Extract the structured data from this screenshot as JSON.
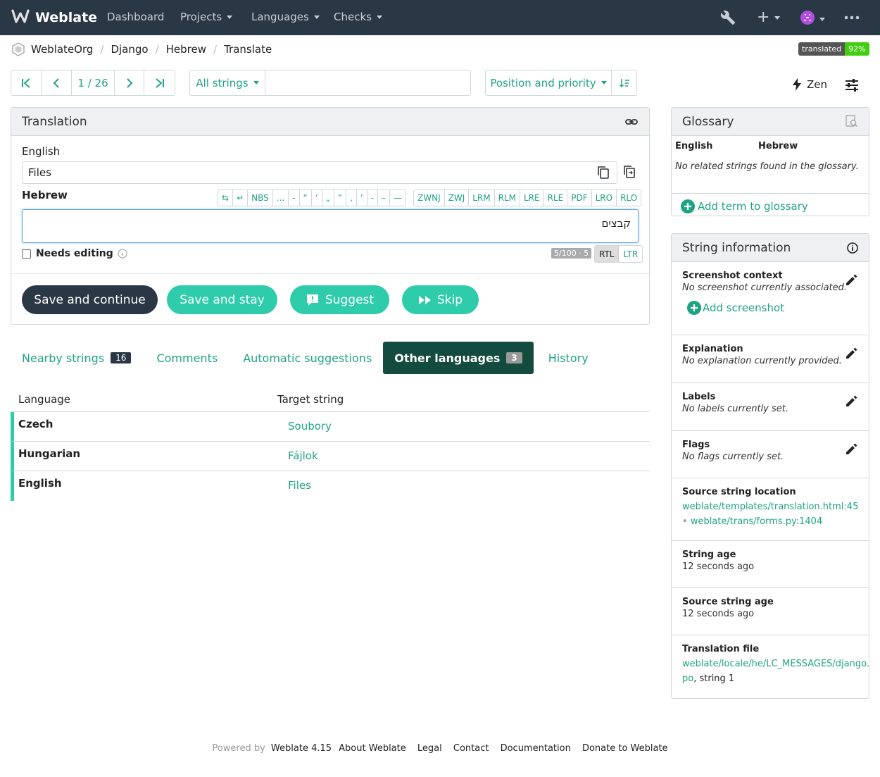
{
  "navbar": {
    "brand": "Weblate",
    "links": [
      "Dashboard",
      "Projects",
      "Languages",
      "Checks"
    ],
    "icons": [
      "wrench-icon",
      "plus-icon",
      "avatar-icon",
      "more-icon"
    ]
  },
  "breadcrumb": {
    "items": [
      "WeblateOrg",
      "Django",
      "Hebrew",
      "Translate"
    ],
    "badge_label": "translated",
    "badge_value": "92%"
  },
  "toolbar": {
    "position": "1 / 26",
    "filter": "All strings",
    "search_value": "",
    "sort": "Position and priority",
    "zen": "Zen"
  },
  "translation": {
    "heading": "Translation",
    "source_lang": "English",
    "source_text": "Files",
    "target_lang": "Hebrew",
    "target_text": "קבצים",
    "chars": [
      "⇆",
      "↵",
      "NBS",
      "...",
      "‐",
      "“",
      "‘",
      "„",
      "”",
      "‚",
      "’",
      "-",
      "–",
      "—"
    ],
    "dir_chars": [
      "ZWNJ",
      "ZWJ",
      "LRM",
      "RLM",
      "LRE",
      "RLE",
      "PDF",
      "LRO",
      "RLO"
    ],
    "needs_editing": "Needs editing",
    "counter": "5/100 · 5",
    "rtl": "RTL",
    "ltr": "LTR",
    "buttons": {
      "save_continue": "Save and continue",
      "save_stay": "Save and stay",
      "suggest": "Suggest",
      "skip": "Skip"
    }
  },
  "tabs": [
    {
      "label": "Nearby strings",
      "count": "16"
    },
    {
      "label": "Comments",
      "count": ""
    },
    {
      "label": "Automatic suggestions",
      "count": ""
    },
    {
      "label": "Other languages",
      "count": "3"
    },
    {
      "label": "History",
      "count": ""
    }
  ],
  "other_languages": {
    "headers": [
      "Language",
      "Target string"
    ],
    "rows": [
      {
        "language": "Czech",
        "target": "Soubory"
      },
      {
        "language": "Hungarian",
        "target": "Fájlok"
      },
      {
        "language": "English",
        "target": "Files"
      }
    ]
  },
  "glossary": {
    "heading": "Glossary",
    "col_source": "English",
    "col_target": "Hebrew",
    "empty": "No related strings found in the glossary.",
    "add": "Add term to glossary"
  },
  "string_info": {
    "heading": "String information",
    "screenshot_title": "Screenshot context",
    "screenshot_value": "No screenshot currently associated.",
    "add_screenshot": "Add screenshot",
    "explanation_title": "Explanation",
    "explanation_value": "No explanation currently provided.",
    "labels_title": "Labels",
    "labels_value": "No labels currently set.",
    "flags_title": "Flags",
    "flags_value": "No flags currently set.",
    "location_title": "Source string location",
    "location_1": "weblate/templates/translation.html:45",
    "location_sep": "•",
    "location_2": "weblate/trans/forms.py:1404",
    "age_title": "String age",
    "age_value": "12 seconds ago",
    "source_age_title": "Source string age",
    "source_age_value": "12 seconds ago",
    "file_title": "Translation file",
    "file_link_1": "weblate/locale/he/LC_MESSAGES/django.",
    "file_link_2": "po",
    "file_suffix": ", string 1"
  },
  "footer": {
    "powered": "Powered by",
    "version": "Weblate 4.15",
    "links": [
      "About Weblate",
      "Legal",
      "Contact",
      "Documentation",
      "Donate to Weblate"
    ]
  },
  "colors": {
    "navbar": "#2a3744",
    "accent": "#1fa385",
    "accent_button": "#2eccaa",
    "dark_button": "#2a3744",
    "active_tab": "#134b3e"
  }
}
